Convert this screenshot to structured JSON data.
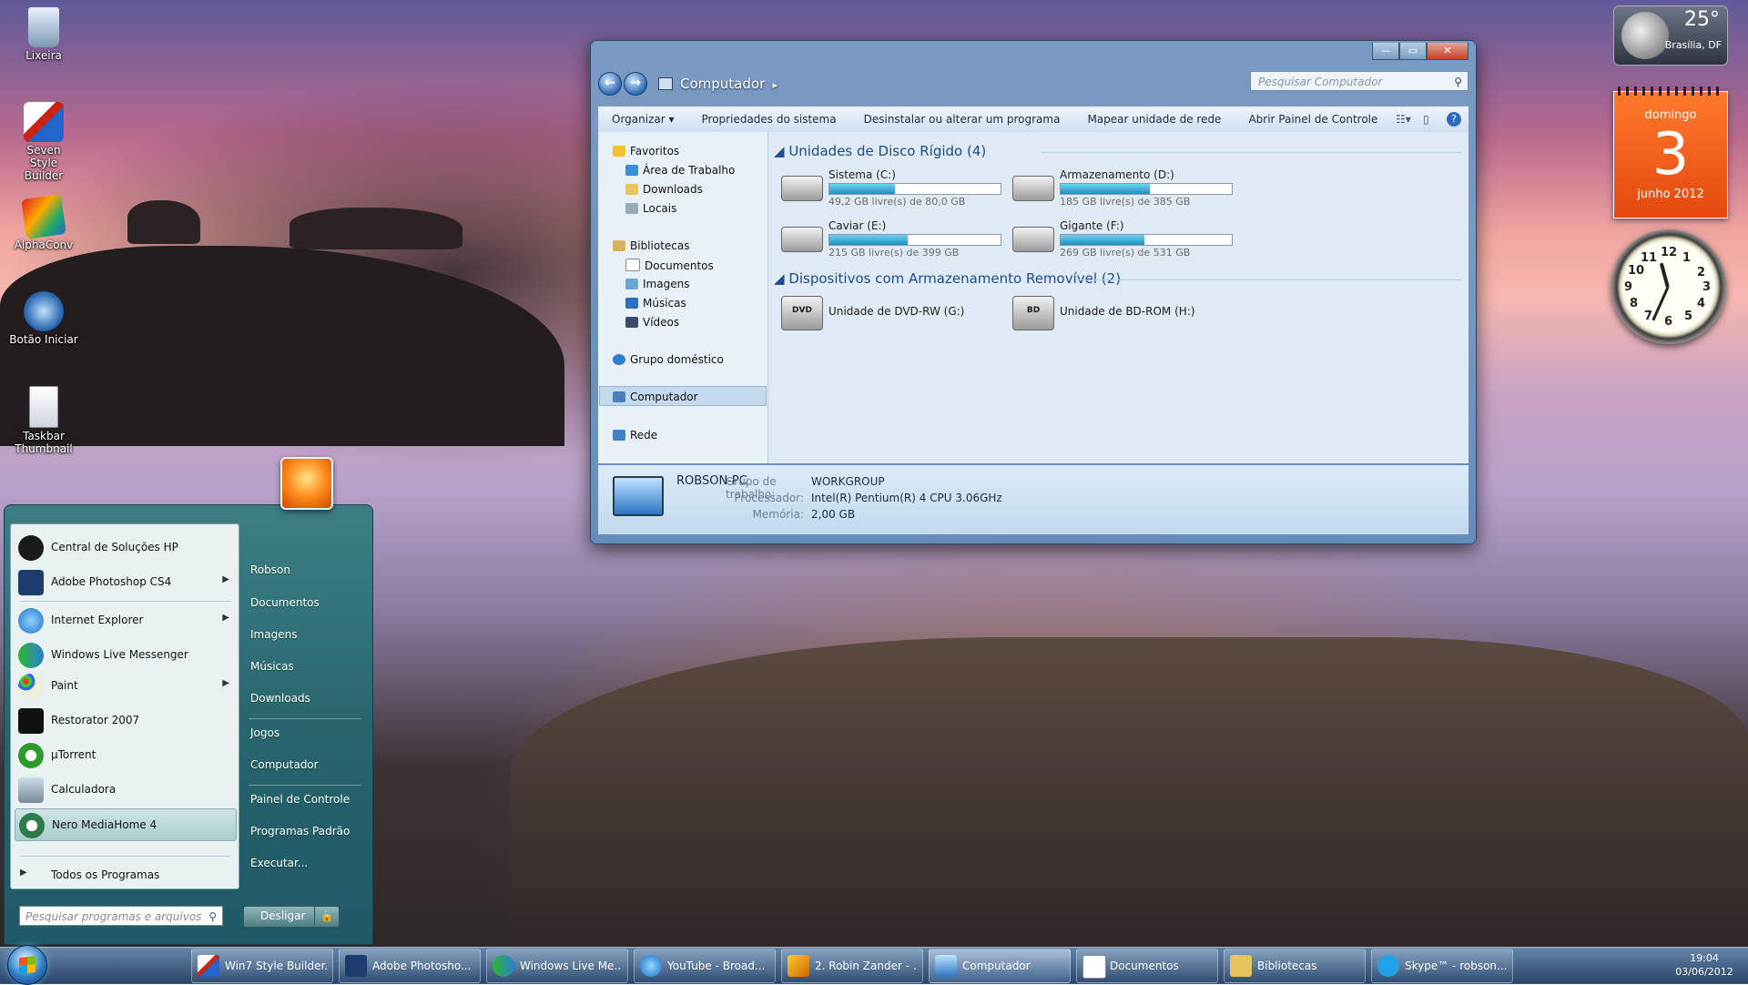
{
  "desktop": {
    "icons": [
      {
        "label": "Lixeira"
      },
      {
        "label": "Seven Style Builder"
      },
      {
        "label": "AlphaConv"
      },
      {
        "label": "Botão Iniciar"
      },
      {
        "label": "Taskbar Thumbnail"
      }
    ]
  },
  "gadgets": {
    "weather": {
      "temp": "25°",
      "location": "Brasília, DF"
    },
    "calendar": {
      "weekday": "domingo",
      "day": "3",
      "month_year": "junho 2012"
    },
    "clock": {
      "numerals": [
        "12",
        "1",
        "2",
        "3",
        "4",
        "5",
        "6",
        "7",
        "8",
        "9",
        "10",
        "11"
      ]
    }
  },
  "explorer": {
    "breadcrumb": "Computador",
    "search_placeholder": "Pesquisar Computador",
    "toolbar": [
      "Organizar",
      "Propriedades do sistema",
      "Desinstalar ou alterar um programa",
      "Mapear unidade de rede",
      "Abrir Painel de Controle"
    ],
    "nav": {
      "favoritos": "Favoritos",
      "fav_items": [
        "Área de Trabalho",
        "Downloads",
        "Locais"
      ],
      "bibliotecas": "Bibliotecas",
      "lib_items": [
        "Documentos",
        "Imagens",
        "Músicas",
        "Vídeos"
      ],
      "grupo": "Grupo doméstico",
      "computador": "Computador",
      "rede": "Rede"
    },
    "hdd_group": "Unidades de Disco Rígido (4)",
    "drives": [
      {
        "name": "Sistema (C:)",
        "free": "49,2 GB livre(s) de 80,0 GB",
        "used_fraction": 0.385
      },
      {
        "name": "Armazenamento (D:)",
        "free": "185 GB livre(s) de 385 GB",
        "used_fraction": 0.52
      },
      {
        "name": "Caviar (E:)",
        "free": "215 GB livre(s) de 399 GB",
        "used_fraction": 0.46
      },
      {
        "name": "Gigante (F:)",
        "free": "269 GB livre(s) de 531 GB",
        "used_fraction": 0.49
      }
    ],
    "removable_group": "Dispositivos com Armazenamento Removível (2)",
    "removable": [
      {
        "name": "Unidade de DVD-RW (G:)",
        "badge": "DVD"
      },
      {
        "name": "Unidade de BD-ROM (H:)",
        "badge": "BD"
      }
    ],
    "details": {
      "pc_name": "ROBSON-PC",
      "workgroup_label": "Grupo de trabalho:",
      "workgroup": "WORKGROUP",
      "cpu_label": "Processador:",
      "cpu": "Intel(R) Pentium(R) 4 CPU 3.06GHz",
      "mem_label": "Memória:",
      "mem": "2,00 GB"
    }
  },
  "start_menu": {
    "programs": [
      "Central de Soluções HP",
      "Adobe Photoshop CS4",
      "Internet Explorer",
      "Windows Live Messenger",
      "Paint",
      "Restorator 2007",
      "µTorrent",
      "Calculadora",
      "Nero MediaHome 4"
    ],
    "all_programs": "Todos os Programas",
    "right_items": [
      "Robson",
      "Documentos",
      "Imagens",
      "Músicas",
      "Downloads",
      "Jogos",
      "Computador",
      "Painel de Controle",
      "Programas Padrão",
      "Executar..."
    ],
    "search_placeholder": "Pesquisar programas e arquivos",
    "shutdown": "Desligar"
  },
  "taskbar": {
    "tasks": [
      "Win7 Style Builder...",
      "Adobe Photosho...",
      "Windows Live Me...",
      "YouTube - Broad...",
      "2. Robin Zander - ...",
      "Computador",
      "Documentos",
      "Bibliotecas",
      "Skype™ - robson...."
    ],
    "time": "19:04",
    "date": "03/06/2012"
  }
}
